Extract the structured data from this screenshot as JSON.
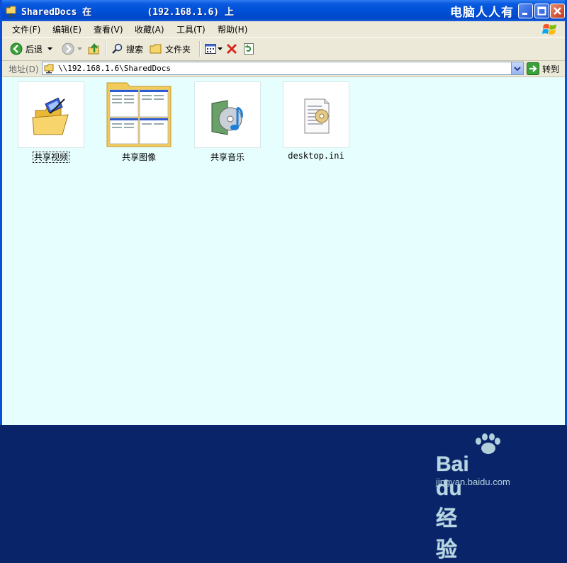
{
  "window": {
    "title": "SharedDocs 在          (192.168.1.6) 上",
    "watermark": "电脑人人有"
  },
  "menu": {
    "items": [
      {
        "label": "文件(F)"
      },
      {
        "label": "编辑(E)"
      },
      {
        "label": "查看(V)"
      },
      {
        "label": "收藏(A)"
      },
      {
        "label": "工具(T)"
      },
      {
        "label": "帮助(H)"
      }
    ]
  },
  "toolbar": {
    "back_label": "后退",
    "search_label": "搜索",
    "folders_label": "文件夹"
  },
  "address": {
    "label": "地址(D)",
    "value": "\\\\192.168.1.6\\SharedDocs",
    "go_label": "转到"
  },
  "files": [
    {
      "name": "共享视频",
      "icon": "video-folder-icon",
      "selected": true
    },
    {
      "name": "共享图像",
      "icon": "image-folder-icon",
      "selected": false
    },
    {
      "name": "共享音乐",
      "icon": "music-folder-icon",
      "selected": false
    },
    {
      "name": "desktop.ini",
      "icon": "ini-file-icon",
      "selected": false
    }
  ],
  "watermark": {
    "brand": "Bai du 经验",
    "url": "jingyan.baidu.com"
  },
  "colors": {
    "title_blue": "#0050d8",
    "content_bg": "#e6fefe",
    "chrome": "#ece9d8"
  }
}
